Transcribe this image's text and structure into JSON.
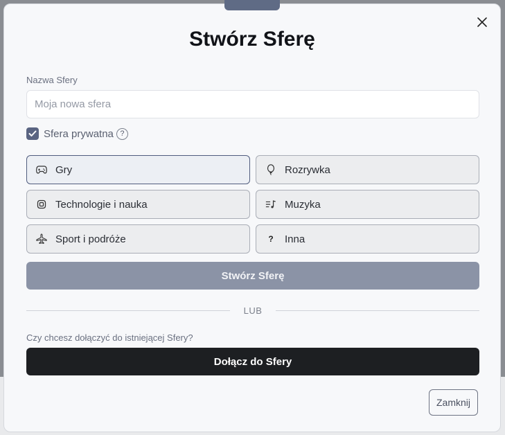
{
  "modal": {
    "title": "Stwórz Sferę",
    "name_label": "Nazwa Sfery",
    "name_value": "",
    "name_placeholder": "Moja nowa sfera",
    "private_label": "Sfera prywatna",
    "private_checked": true,
    "help_glyph": "?",
    "categories": [
      {
        "label": "Gry",
        "icon": "gamepad-icon",
        "selected": true
      },
      {
        "label": "Rozrywka",
        "icon": "balloon-icon",
        "selected": false
      },
      {
        "label": "Technologie i nauka",
        "icon": "chip-icon",
        "selected": false
      },
      {
        "label": "Muzyka",
        "icon": "music-list-icon",
        "selected": false
      },
      {
        "label": "Sport i podróże",
        "icon": "plane-icon",
        "selected": false
      },
      {
        "label": "Inna",
        "icon": "question-icon",
        "selected": false
      }
    ],
    "other_glyph": "?",
    "create_label": "Stwórz Sferę",
    "divider_label": "LUB",
    "join_question": "Czy chcesz dołączyć do istniejącej Sfery?",
    "join_label": "Dołącz do Sfery",
    "close_label": "Zamknij"
  },
  "colors": {
    "accent": "#5a6482",
    "create_disabled": "#8b93a6",
    "join_dark": "#1d1f22"
  }
}
